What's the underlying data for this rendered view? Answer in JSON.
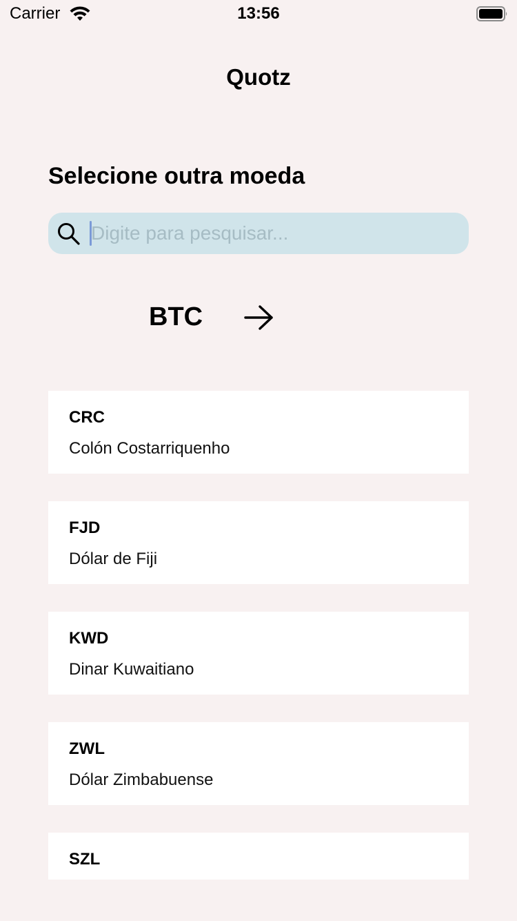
{
  "status_bar": {
    "carrier": "Carrier",
    "time": "13:56"
  },
  "header": {
    "title": "Quotz"
  },
  "section": {
    "title": "Selecione outra moeda"
  },
  "search": {
    "placeholder": "Digite para pesquisar...",
    "value": ""
  },
  "conversion": {
    "from": "BTC"
  },
  "currencies": [
    {
      "code": "CRC",
      "name": "Colón Costarriquenho"
    },
    {
      "code": "FJD",
      "name": "Dólar de Fiji"
    },
    {
      "code": "KWD",
      "name": "Dinar Kuwaitiano"
    },
    {
      "code": "ZWL",
      "name": "Dólar Zimbabuense"
    },
    {
      "code": "SZL",
      "name": ""
    }
  ],
  "colors": {
    "background": "#f8f1f1",
    "search_background": "#d0e4ea",
    "card": "#ffffff",
    "caret": "#7b9ad7"
  },
  "icons": {
    "wifi": "wifi-icon",
    "battery": "battery-icon",
    "search": "search-icon",
    "arrow": "arrow-right-icon"
  }
}
